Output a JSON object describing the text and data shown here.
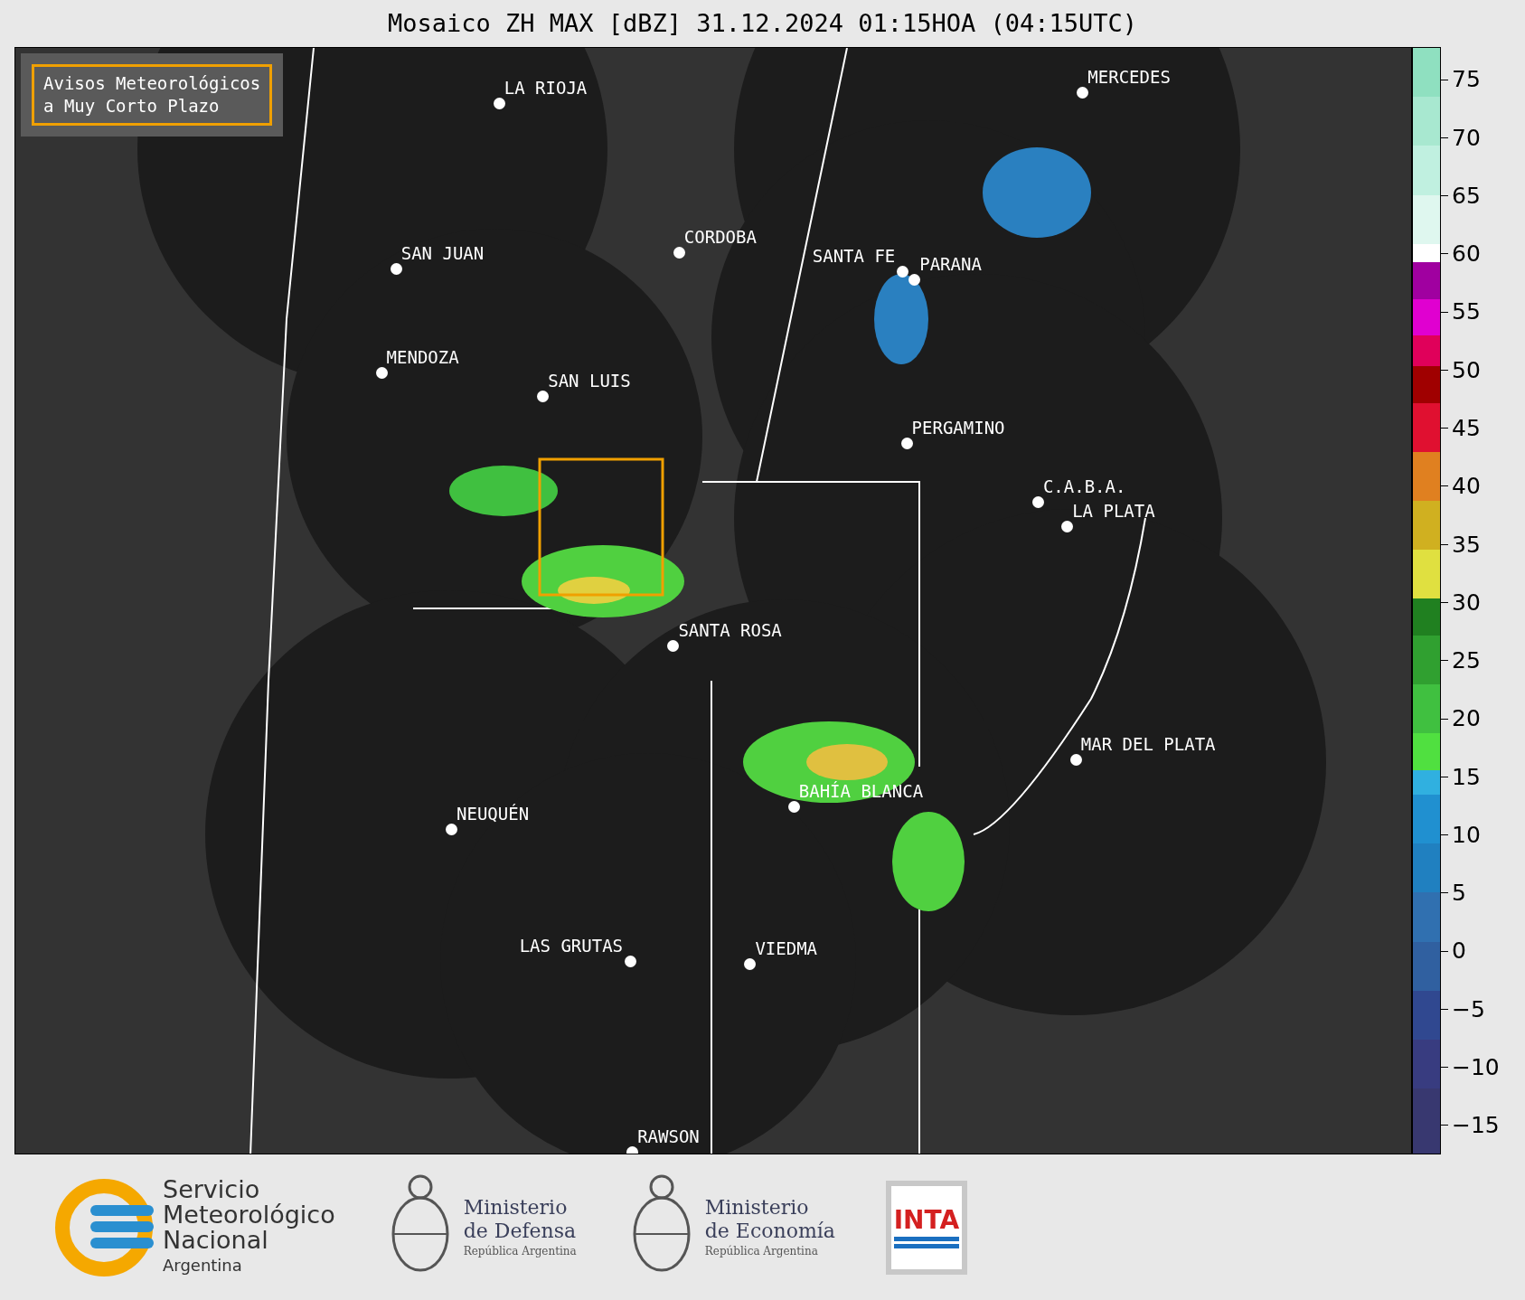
{
  "title": "Mosaico ZH MAX [dBZ] 31.12.2024 01:15HOA (04:15UTC)",
  "notice": {
    "lines": [
      "Avisos Meteorológicos",
      "a Muy Corto Plazo"
    ]
  },
  "cities": [
    {
      "name": "LA RIOJA"
    },
    {
      "name": "SAN JUAN"
    },
    {
      "name": "CORDOBA"
    },
    {
      "name": "SANTA FE"
    },
    {
      "name": "PARANA"
    },
    {
      "name": "MERCEDES"
    },
    {
      "name": "MENDOZA"
    },
    {
      "name": "SAN LUIS"
    },
    {
      "name": "PERGAMINO"
    },
    {
      "name": "C.A.B.A."
    },
    {
      "name": "LA PLATA"
    },
    {
      "name": "SANTA ROSA"
    },
    {
      "name": "MAR DEL PLATA"
    },
    {
      "name": "NEUQUÉN"
    },
    {
      "name": "BAHÍA BLANCA"
    },
    {
      "name": "LAS GRUTAS"
    },
    {
      "name": "VIEDMA"
    },
    {
      "name": "RAWSON"
    }
  ],
  "colorbar": {
    "ticks": [
      "75",
      "70",
      "65",
      "60",
      "55",
      "50",
      "45",
      "40",
      "35",
      "30",
      "25",
      "20",
      "15",
      "10",
      "5",
      "0",
      "−5",
      "−10",
      "−15"
    ]
  },
  "footer": {
    "smn": {
      "lines": [
        "Servicio",
        "Meteorológico",
        "Nacional"
      ],
      "sub": "Argentina"
    },
    "ministries": [
      {
        "name": "Ministerio",
        "sub_name": "de Defensa",
        "country": "República Argentina"
      },
      {
        "name": "Ministerio",
        "sub_name": "de Economía",
        "country": "República Argentina"
      }
    ],
    "inta": "INTA"
  }
}
